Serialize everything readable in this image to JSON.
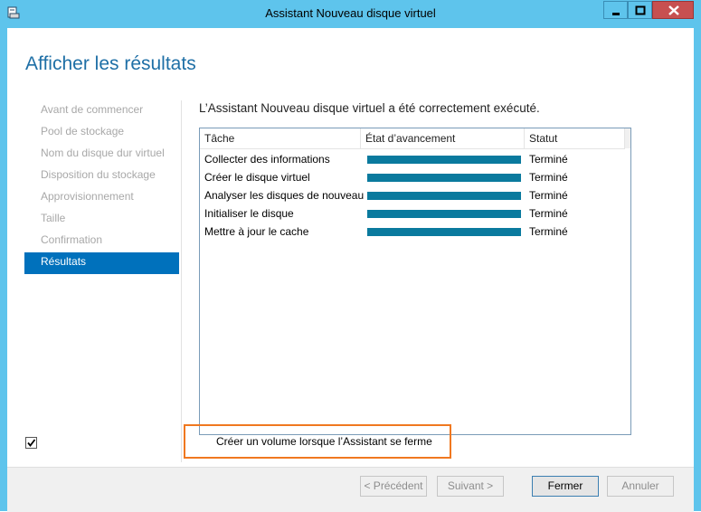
{
  "window": {
    "title": "Assistant Nouveau disque virtuel",
    "controls": [
      "minimize-icon",
      "maximize-icon",
      "close-icon"
    ]
  },
  "header": {
    "title": "Afficher les résultats"
  },
  "nav": {
    "items": [
      {
        "label": "Avant de commencer",
        "active": false
      },
      {
        "label": "Pool de stockage",
        "active": false
      },
      {
        "label": "Nom du disque dur virtuel",
        "active": false
      },
      {
        "label": "Disposition du stockage",
        "active": false
      },
      {
        "label": "Approvisionnement",
        "active": false
      },
      {
        "label": "Taille",
        "active": false
      },
      {
        "label": "Confirmation",
        "active": false
      },
      {
        "label": "Résultats",
        "active": true
      }
    ]
  },
  "main": {
    "success_message": "L’Assistant Nouveau disque virtuel a été correctement exécuté.",
    "table": {
      "columns": [
        "Tâche",
        "État d’avancement",
        "Statut"
      ],
      "rows": [
        {
          "task": "Collecter des informations",
          "progress": 1.0,
          "status": "Terminé"
        },
        {
          "task": "Créer le disque virtuel",
          "progress": 1.0,
          "status": "Terminé"
        },
        {
          "task": "Analyser les disques de nouveau",
          "progress": 1.0,
          "status": "Terminé"
        },
        {
          "task": "Initialiser le disque",
          "progress": 1.0,
          "status": "Terminé"
        },
        {
          "task": "Mettre à jour le cache",
          "progress": 1.0,
          "status": "Terminé"
        }
      ]
    },
    "create_volume": {
      "label": "Créer un volume lorsque l’Assistant se ferme",
      "checked": true
    }
  },
  "footer": {
    "previous_label": "< Précédent",
    "next_label": "Suivant >",
    "close_label": "Fermer",
    "cancel_label": "Annuler"
  },
  "colors": {
    "titlebar": "#5ec4ec",
    "accent": "#0071bc",
    "progress": "#0a7a9e",
    "highlight_box": "#f07820"
  }
}
